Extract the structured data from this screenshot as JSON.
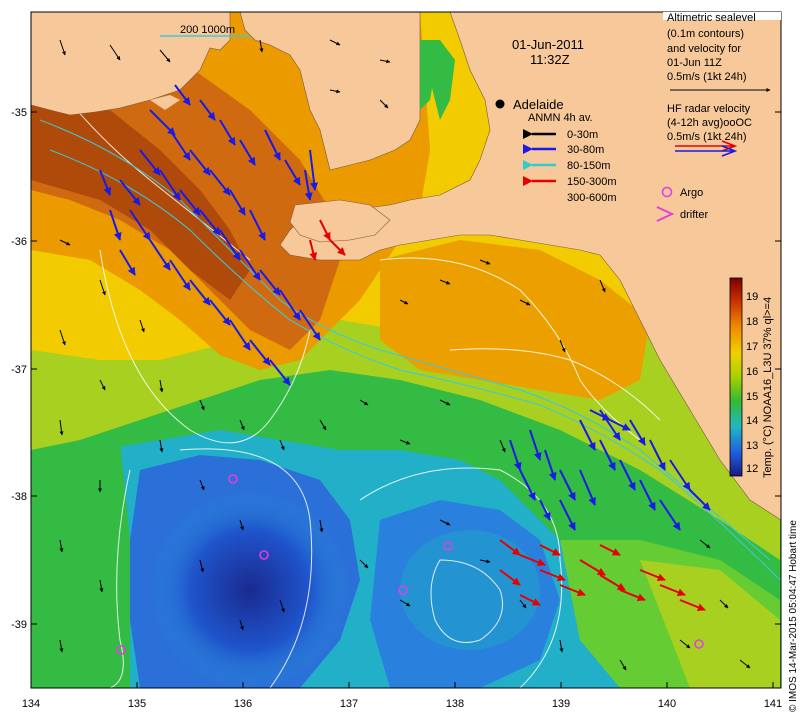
{
  "header": {
    "date": "01-Jun-2011",
    "time": "11:32Z",
    "depth_legend": "200  1000m"
  },
  "legend_sealevel": {
    "lines": [
      "Altimetric sealevel",
      "(0.1m contours)",
      "and velocity for",
      "01-Jun 11Z",
      "0.5m/s (1kt 24h)"
    ]
  },
  "legend_radar": {
    "lines": [
      "HF radar velocity",
      "(4-12h avg)ooOC",
      "0.5m/s (1kt 24h)"
    ]
  },
  "place": {
    "adelaide": "Adelaide"
  },
  "anmn": {
    "title": "ANMN 4h av.",
    "items": [
      {
        "label": "0-30m",
        "color": "#000000"
      },
      {
        "label": "30-80m",
        "color": "#1a1ae6"
      },
      {
        "label": "80-150m",
        "color": "#33cccc"
      },
      {
        "label": "150-300m",
        "color": "#e60000"
      },
      {
        "label": "300-600m",
        "color": "#e6a000"
      }
    ]
  },
  "markers": {
    "argo": "Argo",
    "drifter": "drifter"
  },
  "colorbar": {
    "ticks": [
      "19",
      "18",
      "17",
      "16",
      "15",
      "14",
      "13",
      "12"
    ],
    "label": "Temp. (°C) NOAA16_L3U 37% ql>=4"
  },
  "credit": "© IMOS 14-Mar-2015 05:04:47 Hobart time",
  "axes": {
    "x_ticks": [
      "134",
      "135",
      "136",
      "137",
      "138",
      "139",
      "140",
      "141"
    ],
    "y_ticks": [
      "-35",
      "-36",
      "-37",
      "-38",
      "-39"
    ]
  },
  "colors": {
    "land": "#f7c89a",
    "ocean_warm": "#d46a10",
    "ocean_mid": "#f2c200",
    "ocean_green": "#33bb33",
    "ocean_cool": "#1a66cc",
    "ocean_cold": "#1a1a80"
  }
}
